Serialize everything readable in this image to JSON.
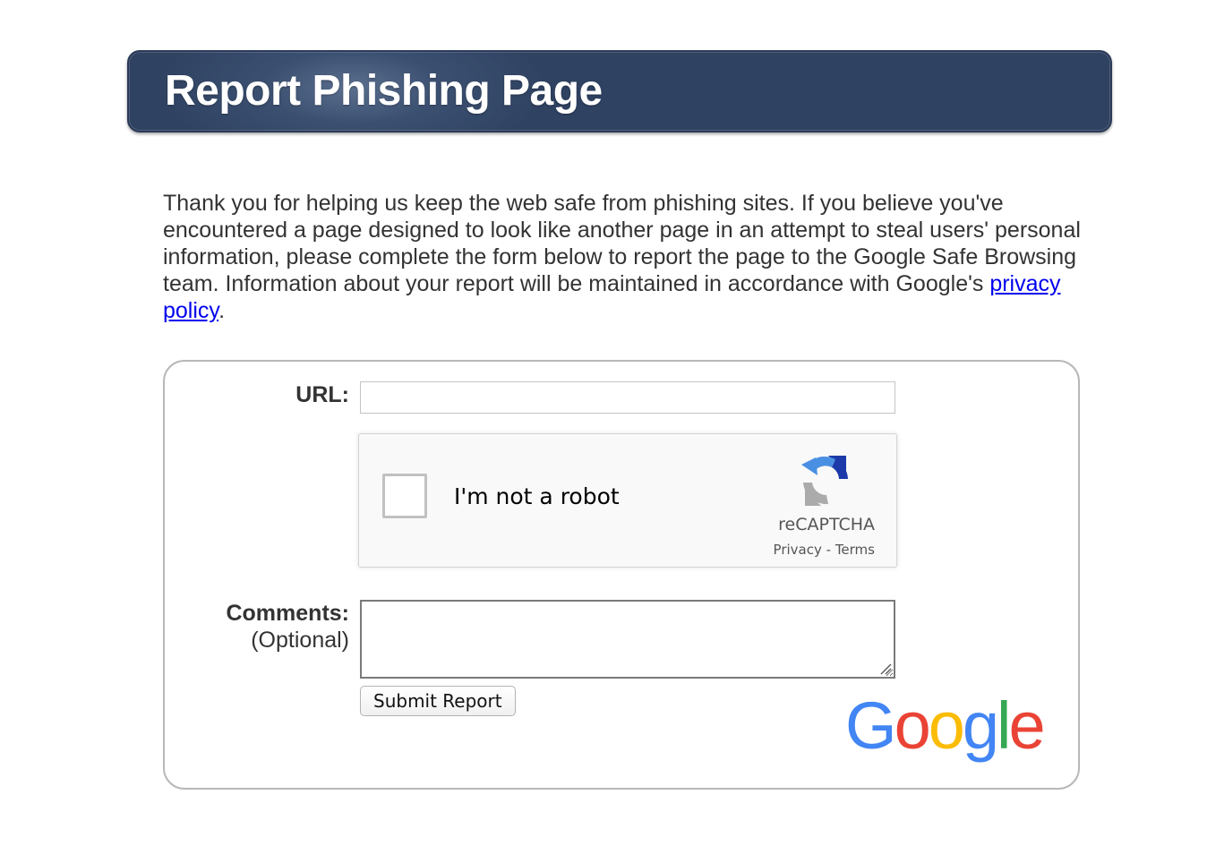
{
  "header": {
    "title": "Report Phishing Page"
  },
  "intro": {
    "text": "Thank you for helping us keep the web safe from phishing sites. If you believe you've encountered a page designed to look like another page in an attempt to steal users' personal information, please complete the form below to report the page to the Google Safe Browsing team. Information about your report will be maintained in accordance with Google's ",
    "link_label": "privacy policy",
    "trailing": "."
  },
  "form": {
    "url_label": "URL:",
    "url_value": "",
    "captcha": {
      "label": "I'm not a robot",
      "checked": false,
      "brand": "reCAPTCHA",
      "privacy_link": "Privacy",
      "separator": " - ",
      "terms_link": "Terms"
    },
    "comments_label": "Comments:",
    "comments_optional": "(Optional)",
    "comments_value": "",
    "submit_label": "Submit Report"
  },
  "footer": {
    "logo_letters": [
      "G",
      "o",
      "o",
      "g",
      "l",
      "e"
    ],
    "logo_colors": [
      "#4285F4",
      "#EA4335",
      "#FBBC05",
      "#4285F4",
      "#34A853",
      "#EA4335"
    ]
  },
  "colors": {
    "banner": "#34476a",
    "link": "#0000ee",
    "border": "#b8b8b8"
  }
}
